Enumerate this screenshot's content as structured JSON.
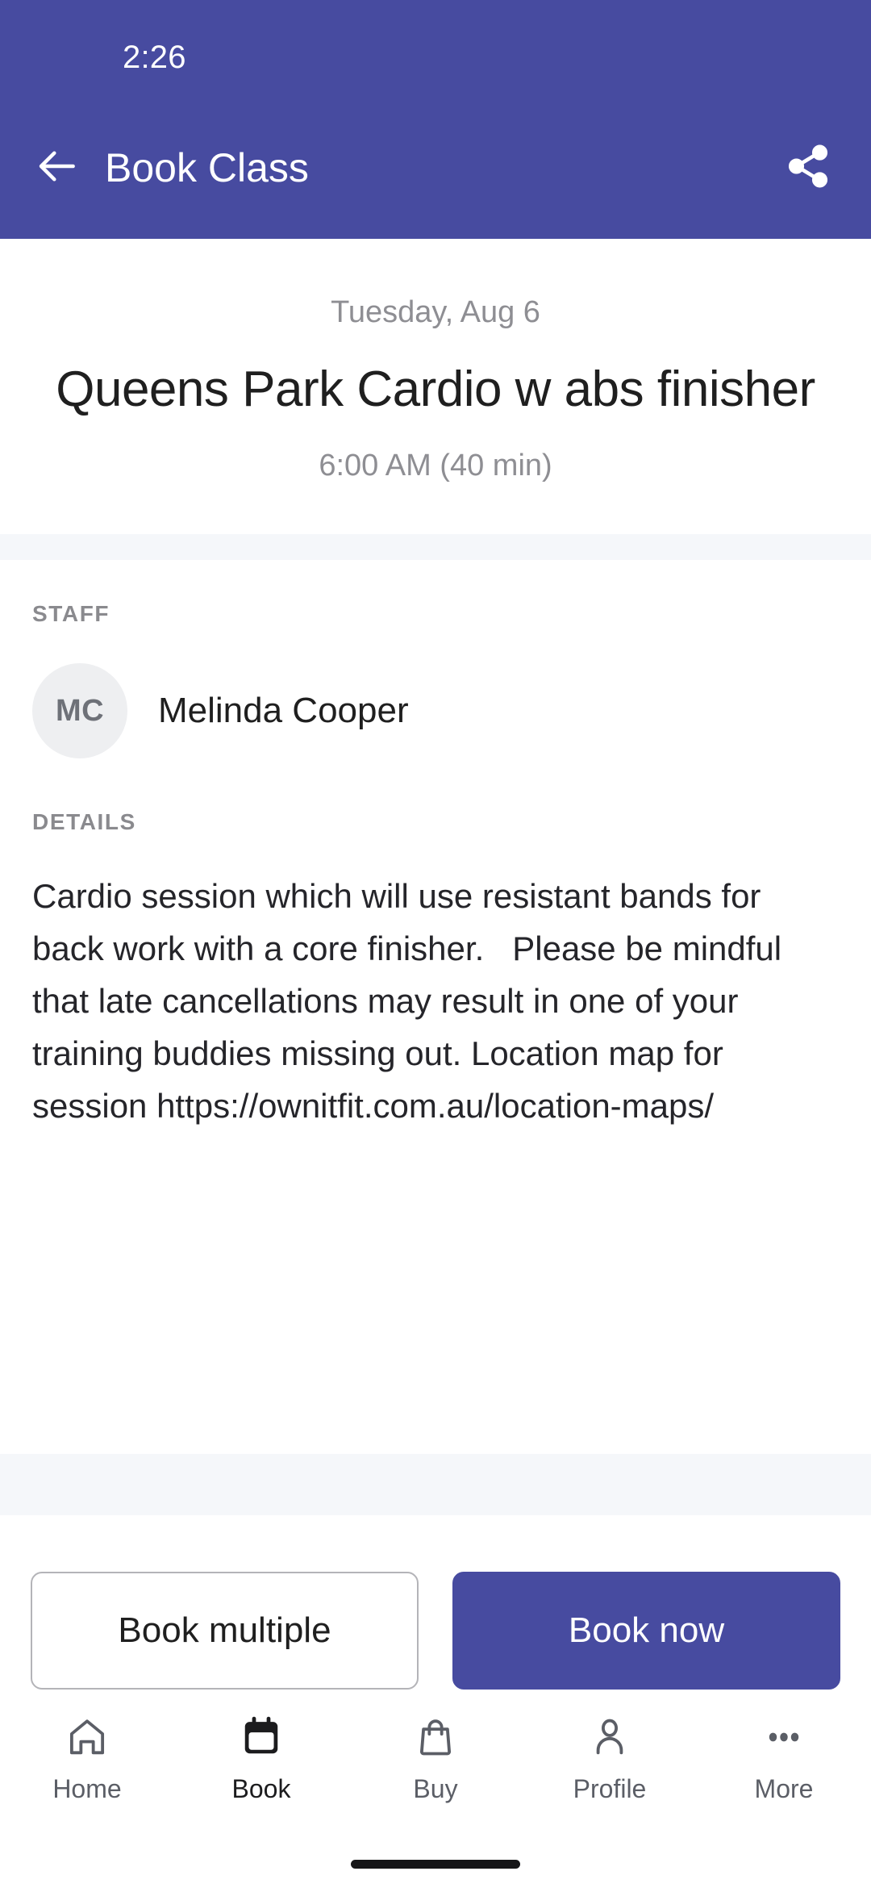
{
  "status_bar": {
    "time": "2:26",
    "background_color": "#474BA0"
  },
  "app_bar": {
    "title": "Book Class",
    "back_icon": "arrow-left-icon",
    "share_icon": "share-icon",
    "background_color": "#474BA0",
    "text_color": "#ffffff"
  },
  "class_header": {
    "date": "Tuesday, Aug 6",
    "title": "Queens Park Cardio w abs finisher",
    "time": "6:00 AM (40 min)"
  },
  "staff": {
    "section_label": "STAFF",
    "members": [
      {
        "initials": "MC",
        "name": "Melinda Cooper"
      }
    ]
  },
  "details": {
    "section_label": "DETAILS",
    "text": "Cardio session which will use resistant bands for back work with a core finisher.   Please be mindful that late cancellations may result in one of your training buddies missing out. Location map for session https://ownitfit.com.au/location-maps/"
  },
  "actions": {
    "secondary_label": "Book multiple",
    "primary_label": "Book now",
    "primary_color": "#474BA0"
  },
  "bottom_nav": {
    "items": [
      {
        "label": "Home",
        "icon": "home-icon",
        "active": false
      },
      {
        "label": "Book",
        "icon": "calendar-icon",
        "active": true
      },
      {
        "label": "Buy",
        "icon": "shopping-bag-icon",
        "active": false
      },
      {
        "label": "Profile",
        "icon": "person-icon",
        "active": false
      },
      {
        "label": "More",
        "icon": "ellipsis-icon",
        "active": false
      }
    ]
  },
  "system": {
    "home_indicator": "home-indicator"
  }
}
